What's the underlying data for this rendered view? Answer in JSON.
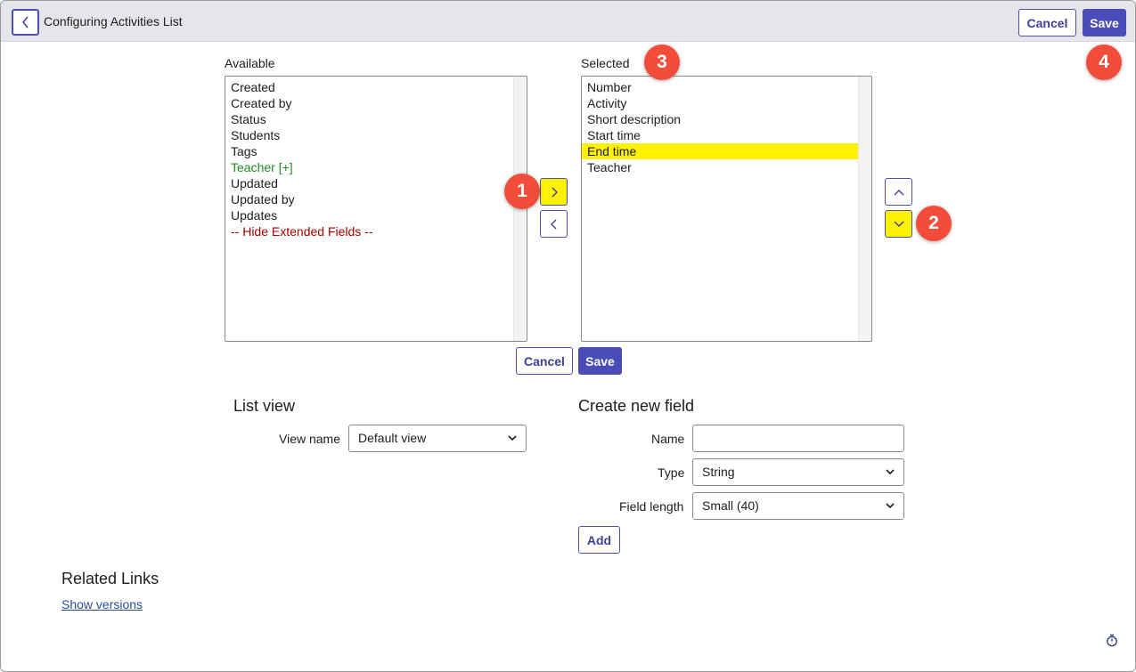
{
  "header": {
    "title": "Configuring Activities List",
    "cancel_label": "Cancel",
    "save_label": "Save"
  },
  "available": {
    "label": "Available",
    "items": [
      {
        "label": "Created",
        "color": "#1d1d1d"
      },
      {
        "label": "Created by",
        "color": "#1d1d1d"
      },
      {
        "label": "Status",
        "color": "#1d1d1d"
      },
      {
        "label": "Students",
        "color": "#1d1d1d"
      },
      {
        "label": "Tags",
        "color": "#1d1d1d"
      },
      {
        "label": "Teacher [+]",
        "color": "#218a21"
      },
      {
        "label": "Updated",
        "color": "#1d1d1d"
      },
      {
        "label": "Updated by",
        "color": "#1d1d1d"
      },
      {
        "label": "Updates",
        "color": "#1d1d1d"
      },
      {
        "label": "-- Hide Extended Fields --",
        "color": "#a30000"
      }
    ]
  },
  "selected": {
    "label": "Selected",
    "items": [
      {
        "label": "Number",
        "highlighted": false
      },
      {
        "label": "Activity",
        "highlighted": false
      },
      {
        "label": "Short description",
        "highlighted": false
      },
      {
        "label": "Start time",
        "highlighted": false
      },
      {
        "label": "End time",
        "highlighted": true
      },
      {
        "label": "Teacher",
        "highlighted": false
      }
    ]
  },
  "mid_actions": {
    "cancel_label": "Cancel",
    "save_label": "Save"
  },
  "badges": [
    "1",
    "2",
    "3",
    "4"
  ],
  "list_view": {
    "heading": "List view",
    "view_name_label": "View name",
    "view_name_value": "Default view"
  },
  "new_field": {
    "heading": "Create new field",
    "name_label": "Name",
    "name_value": "",
    "type_label": "Type",
    "type_value": "String",
    "length_label": "Field length",
    "length_value": "Small (40)",
    "add_label": "Add"
  },
  "related": {
    "heading": "Related Links",
    "show_versions": "Show versions"
  },
  "colors": {
    "accent": "#4a4db8",
    "highlight": "#fff200",
    "badge": "#f24d3b"
  },
  "icons": {
    "back": "chevron-left-icon",
    "add": "chevron-right-icon",
    "remove": "chevron-left-icon",
    "up": "chevron-up-icon",
    "down": "chevron-down-icon",
    "timer": "stopwatch-icon"
  }
}
